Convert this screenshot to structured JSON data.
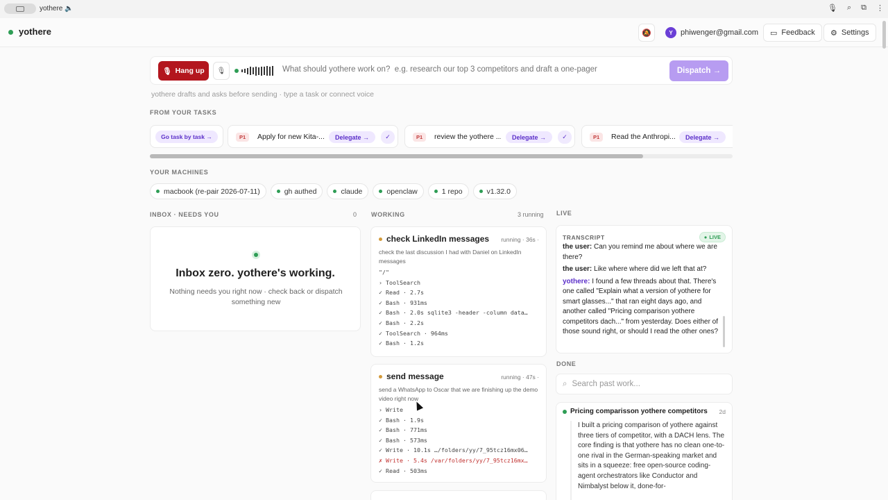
{
  "browser": {
    "tab_title": "yothere 🔈"
  },
  "header": {
    "brand": "yothere",
    "account_email": "phiwenger@gmail.com",
    "avatar_letter": "Y",
    "feedback_label": "Feedback",
    "settings_label": "Settings"
  },
  "dispatch": {
    "hangup_label": "Hang up",
    "placeholder": "What should yothere work on?  e.g. research our top 3 competitors and draft a one-pager",
    "dispatch_label": "Dispatch →",
    "hint": "yothere drafts and asks before sending  ·  type a task or connect voice"
  },
  "tasks": {
    "section_label": "FROM YOUR TASKS",
    "go_task_label": "Go task by task →",
    "items": [
      {
        "priority": "P1",
        "name": "Apply for new Kita-...",
        "delegate": "Delegate →",
        "check": "✓"
      },
      {
        "priority": "P1",
        "name": "review the yothere ...",
        "delegate": "Delegate →",
        "check": "✓"
      },
      {
        "priority": "P1",
        "name": "Read the Anthropi...",
        "delegate": "Delegate →",
        "check": "✓"
      }
    ]
  },
  "machines": {
    "section_label": "YOUR MACHINES",
    "items": [
      "macbook (re-pair 2026-07-11)",
      "gh authed",
      "claude",
      "openclaw",
      "1 repo",
      "v1.32.0"
    ]
  },
  "inbox": {
    "label": "INBOX · NEEDS YOU",
    "count": "0",
    "title": "Inbox zero. yothere's working.",
    "subtitle": "Nothing needs you right now · check back or dispatch something new"
  },
  "working": {
    "label": "WORKING",
    "count": "3 running",
    "cards": [
      {
        "title": "check LinkedIn messages",
        "status": "running · 36s ·",
        "desc": "check the last discussion I had with Daniel on LinkedIn messages",
        "log": [
          "\"/\"",
          "› ToolSearch",
          "✓ Read · 2.7s",
          "✓ Bash · 931ms",
          "✓ Bash · 2.0s sqlite3 -header -column data…",
          "✓ Bash · 2.2s",
          "✓ ToolSearch · 964ms",
          "✓ Bash · 1.2s"
        ]
      },
      {
        "title": "send message",
        "status": "running · 47s ·",
        "desc": "send a WhatsApp to Oscar that we are finishing up the demo video right now",
        "log": [
          "› Write",
          "✓ Bash · 1.9s",
          "✓ Bash · 771ms",
          "✓ Bash · 573ms",
          "✓ Write · 10.1s …/folders/yy/7_95tcz16mx06…",
          "✗ Write · 5.4s /var/folders/yy/7_95tcz16mx…",
          "✓ Read · 503ms"
        ]
      }
    ]
  },
  "live": {
    "label": "LIVE",
    "transcript_label": "TRANSCRIPT",
    "badge": "LIVE",
    "lines": [
      {
        "speaker": "the user:",
        "text": "Can you remind me about where we are there?"
      },
      {
        "speaker": "the user:",
        "text": "Like where where did we left that at?"
      },
      {
        "speaker": "yothere:",
        "text": "I found a few threads about that. There's one called \"Explain what a version of yothere for smart glasses...\" that ran eight days ago, and another called \"Pricing comparison yothere competitors dach...\" from yesterday. Does either of those sound right, or should I read the other ones?"
      }
    ]
  },
  "done": {
    "label": "DONE",
    "search_placeholder": "Search past work...",
    "card": {
      "title": "Pricing comparisson yothere competitors ...",
      "age": "2d",
      "body": "I built a pricing comparison of yothere against three tiers of competitor, with a DACH lens. The core finding is that yothere has no clean one-to-one rival in the German-speaking market and sits in a squeeze: free open-source coding-agent orchestrators like Conductor and Nimbalyst below it, done-for-"
    }
  }
}
